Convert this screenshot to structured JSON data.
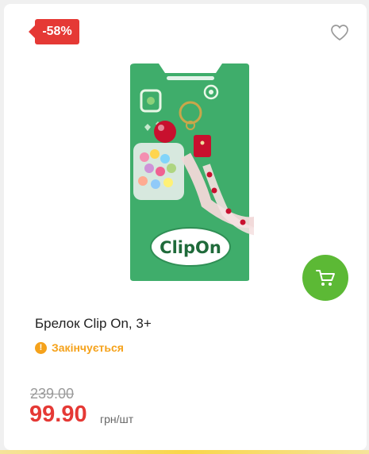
{
  "badge": {
    "discount": "-58%"
  },
  "product": {
    "title": "Брелок Clip On, 3+",
    "status": "Закінчується",
    "image_text": "ClipOn"
  },
  "price": {
    "old": "239.00",
    "current": "99.90",
    "unit": "грн/шт"
  },
  "icons": {
    "favorite": "heart-outline-icon",
    "cart": "cart-icon",
    "status": "exclamation-icon"
  },
  "colors": {
    "discount": "#e53935",
    "cart": "#5cb935",
    "status": "#f5a21b",
    "package": "#3fad6b"
  }
}
